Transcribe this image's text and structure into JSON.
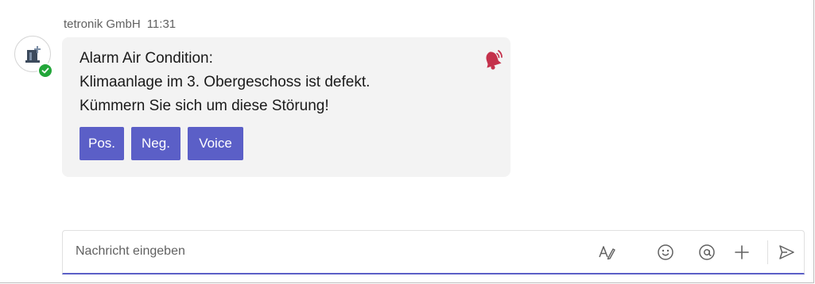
{
  "message": {
    "sender": "tetronik GmbH",
    "time": "11:31",
    "lines": [
      "Alarm Air Condition:",
      "Klimaanlage im 3. Obergeschoss ist defekt.",
      "Kümmern Sie sich um diese Störung!"
    ],
    "actions": [
      "Pos.",
      "Neg.",
      "Voice"
    ],
    "alert_icon": "alarm-bell-icon",
    "presence_status": "available",
    "colors": {
      "button": "#5b5fc7",
      "alert": "#c4314b",
      "presence": "#22a639"
    }
  },
  "compose": {
    "placeholder": "Nachricht eingeben",
    "tools": [
      "format-icon",
      "emoji-icon",
      "mention-icon",
      "add-icon",
      "send-icon"
    ]
  }
}
